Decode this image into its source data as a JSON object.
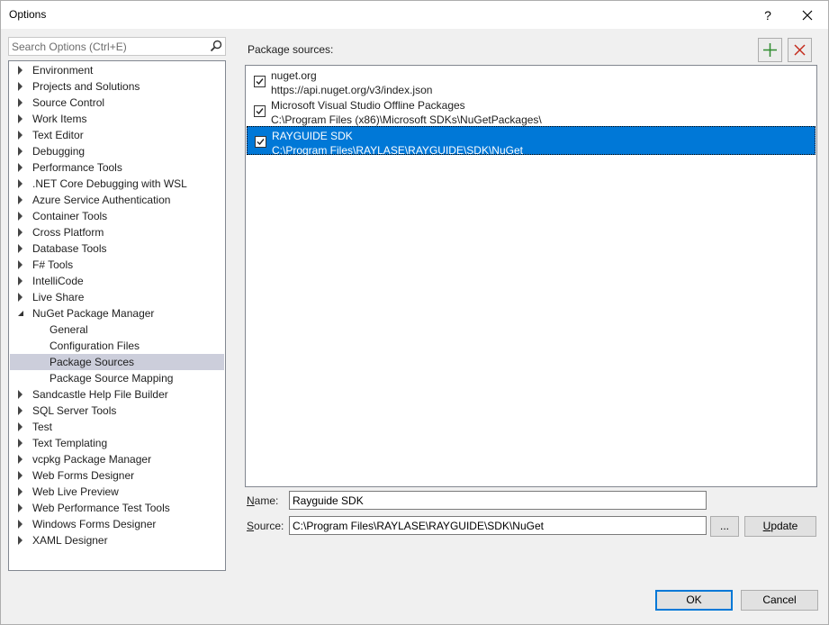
{
  "window": {
    "title": "Options",
    "help_label": "?",
    "close_label": "✕"
  },
  "search": {
    "placeholder": "Search Options (Ctrl+E)"
  },
  "tree": {
    "items": [
      {
        "label": "Environment",
        "level": 0,
        "state": "collapsed"
      },
      {
        "label": "Projects and Solutions",
        "level": 0,
        "state": "collapsed"
      },
      {
        "label": "Source Control",
        "level": 0,
        "state": "collapsed"
      },
      {
        "label": "Work Items",
        "level": 0,
        "state": "collapsed"
      },
      {
        "label": "Text Editor",
        "level": 0,
        "state": "collapsed"
      },
      {
        "label": "Debugging",
        "level": 0,
        "state": "collapsed"
      },
      {
        "label": "Performance Tools",
        "level": 0,
        "state": "collapsed"
      },
      {
        "label": ".NET Core Debugging with WSL",
        "level": 0,
        "state": "collapsed"
      },
      {
        "label": "Azure Service Authentication",
        "level": 0,
        "state": "collapsed"
      },
      {
        "label": "Container Tools",
        "level": 0,
        "state": "collapsed"
      },
      {
        "label": "Cross Platform",
        "level": 0,
        "state": "collapsed"
      },
      {
        "label": "Database Tools",
        "level": 0,
        "state": "collapsed"
      },
      {
        "label": "F# Tools",
        "level": 0,
        "state": "collapsed"
      },
      {
        "label": "IntelliCode",
        "level": 0,
        "state": "collapsed"
      },
      {
        "label": "Live Share",
        "level": 0,
        "state": "collapsed"
      },
      {
        "label": "NuGet Package Manager",
        "level": 0,
        "state": "expanded"
      },
      {
        "label": "General",
        "level": 1
      },
      {
        "label": "Configuration Files",
        "level": 1
      },
      {
        "label": "Package Sources",
        "level": 1,
        "selected": true
      },
      {
        "label": "Package Source Mapping",
        "level": 1
      },
      {
        "label": "Sandcastle Help File Builder",
        "level": 0,
        "state": "collapsed"
      },
      {
        "label": "SQL Server Tools",
        "level": 0,
        "state": "collapsed"
      },
      {
        "label": "Test",
        "level": 0,
        "state": "collapsed"
      },
      {
        "label": "Text Templating",
        "level": 0,
        "state": "collapsed"
      },
      {
        "label": "vcpkg Package Manager",
        "level": 0,
        "state": "collapsed"
      },
      {
        "label": "Web Forms Designer",
        "level": 0,
        "state": "collapsed"
      },
      {
        "label": "Web Live Preview",
        "level": 0,
        "state": "collapsed"
      },
      {
        "label": "Web Performance Test Tools",
        "level": 0,
        "state": "collapsed"
      },
      {
        "label": "Windows Forms Designer",
        "level": 0,
        "state": "collapsed"
      },
      {
        "label": "XAML Designer",
        "level": 0,
        "state": "collapsed"
      }
    ]
  },
  "panel": {
    "heading": "Package sources:",
    "add_icon": "plus-icon",
    "remove_icon": "x-icon",
    "sources": [
      {
        "name": "nuget.org",
        "url": "https://api.nuget.org/v3/index.json",
        "checked": true,
        "selected": false
      },
      {
        "name": "Microsoft Visual Studio Offline Packages",
        "url": "C:\\Program Files (x86)\\Microsoft SDKs\\NuGetPackages\\",
        "checked": true,
        "selected": false
      },
      {
        "name": "RAYGUIDE SDK",
        "url": "C:\\Program Files\\RAYLASE\\RAYGUIDE\\SDK\\NuGet",
        "checked": true,
        "selected": true
      }
    ]
  },
  "form": {
    "name_label_accel": "N",
    "name_label_rest": "ame:",
    "name_value": "Rayguide SDK",
    "source_label_accel": "S",
    "source_label_rest": "ource:",
    "source_value": "C:\\Program Files\\RAYLASE\\RAYGUIDE\\SDK\\NuGet",
    "browse_label": "...",
    "update_label_accel": "U",
    "update_label_rest": "pdate"
  },
  "footer": {
    "ok_label": "OK",
    "cancel_label": "Cancel"
  },
  "colors": {
    "selection": "#0078d7",
    "tree_selection": "#cccedb",
    "add_icon": "#2e8b2e",
    "remove_icon": "#c42b1c"
  }
}
